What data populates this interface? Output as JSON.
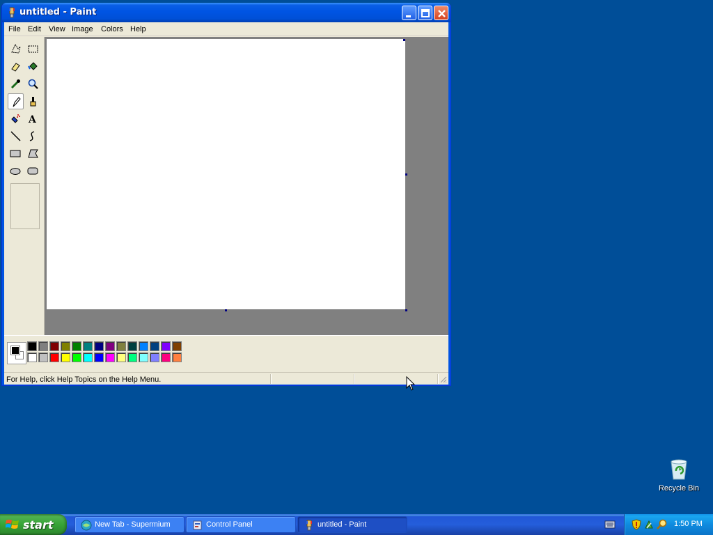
{
  "window": {
    "title": "untitled - Paint",
    "menu": [
      "File",
      "Edit",
      "View",
      "Image",
      "Colors",
      "Help"
    ],
    "status_text": "For Help, click Help Topics on the Help Menu."
  },
  "tools": [
    {
      "name": "free-form-select",
      "icon": "free-select-icon"
    },
    {
      "name": "select",
      "icon": "rect-select-icon"
    },
    {
      "name": "eraser",
      "icon": "eraser-icon"
    },
    {
      "name": "fill-with-color",
      "icon": "paint-bucket-icon"
    },
    {
      "name": "pick-color",
      "icon": "eyedropper-icon"
    },
    {
      "name": "magnifier",
      "icon": "magnifier-icon"
    },
    {
      "name": "pencil",
      "icon": "pencil-icon",
      "active": true
    },
    {
      "name": "brush",
      "icon": "brush-icon"
    },
    {
      "name": "airbrush",
      "icon": "airbrush-icon"
    },
    {
      "name": "text",
      "icon": "text-icon"
    },
    {
      "name": "line",
      "icon": "line-icon"
    },
    {
      "name": "curve",
      "icon": "curve-icon"
    },
    {
      "name": "rectangle",
      "icon": "rectangle-icon"
    },
    {
      "name": "polygon",
      "icon": "polygon-icon"
    },
    {
      "name": "ellipse",
      "icon": "ellipse-icon"
    },
    {
      "name": "rounded-rectangle",
      "icon": "rounded-rect-icon"
    }
  ],
  "palette": {
    "foreground": "#000000",
    "background": "#ffffff",
    "row1": [
      "#000000",
      "#808080",
      "#800000",
      "#808000",
      "#008000",
      "#008080",
      "#000080",
      "#800080",
      "#808040",
      "#004040",
      "#0080ff",
      "#004080",
      "#8000ff",
      "#804000"
    ],
    "row2": [
      "#ffffff",
      "#c0c0c0",
      "#ff0000",
      "#ffff00",
      "#00ff00",
      "#00ffff",
      "#0000ff",
      "#ff00ff",
      "#ffff80",
      "#00ff80",
      "#80ffff",
      "#8080ff",
      "#ff0080",
      "#ff8040"
    ]
  },
  "desktop": {
    "recycle_bin_label": "Recycle Bin"
  },
  "taskbar": {
    "start_label": "start",
    "tasks": [
      {
        "label": "New Tab - Supermium",
        "icon": "browser-icon"
      },
      {
        "label": "Control Panel",
        "icon": "control-panel-icon"
      },
      {
        "label": "untitled - Paint",
        "icon": "paint-icon",
        "active": true
      }
    ],
    "clock": "1:50 PM"
  }
}
